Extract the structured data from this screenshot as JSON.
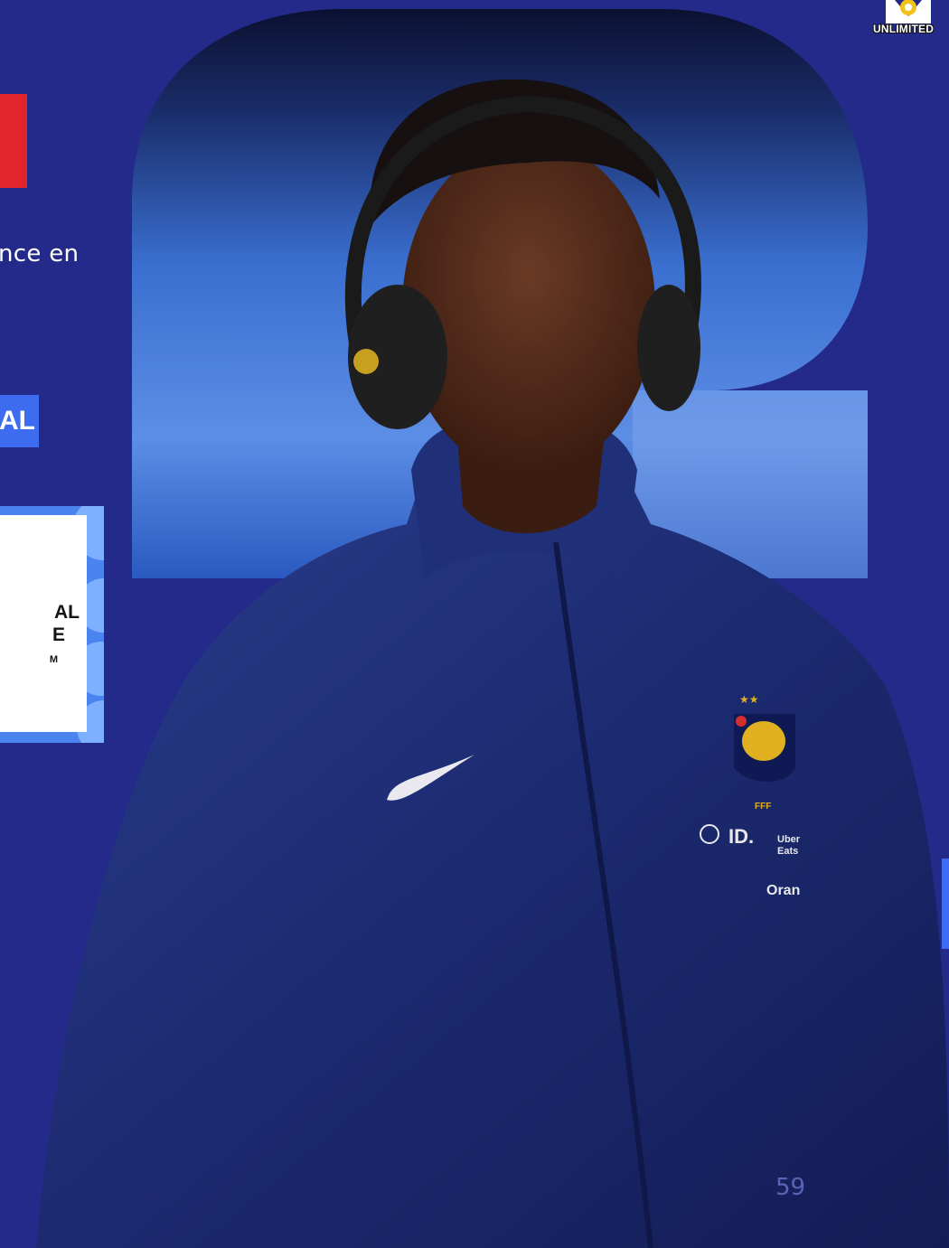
{
  "slide": {
    "intro_fragment": "nce en",
    "tag_fragment": "AL",
    "card": {
      "line1": "AL",
      "line2": "E",
      "line3": "M"
    },
    "logo_word": "UNLIMITED",
    "page_number": "59",
    "jacket_sponsors": [
      "ID.",
      "Uber Eats",
      "Orange"
    ],
    "jacket_badge": "FFF"
  },
  "colors": {
    "background": "#232a8a",
    "accent_red": "#e2252b",
    "accent_blue": "#3d6cf0",
    "jacket": "#1c2a70"
  }
}
